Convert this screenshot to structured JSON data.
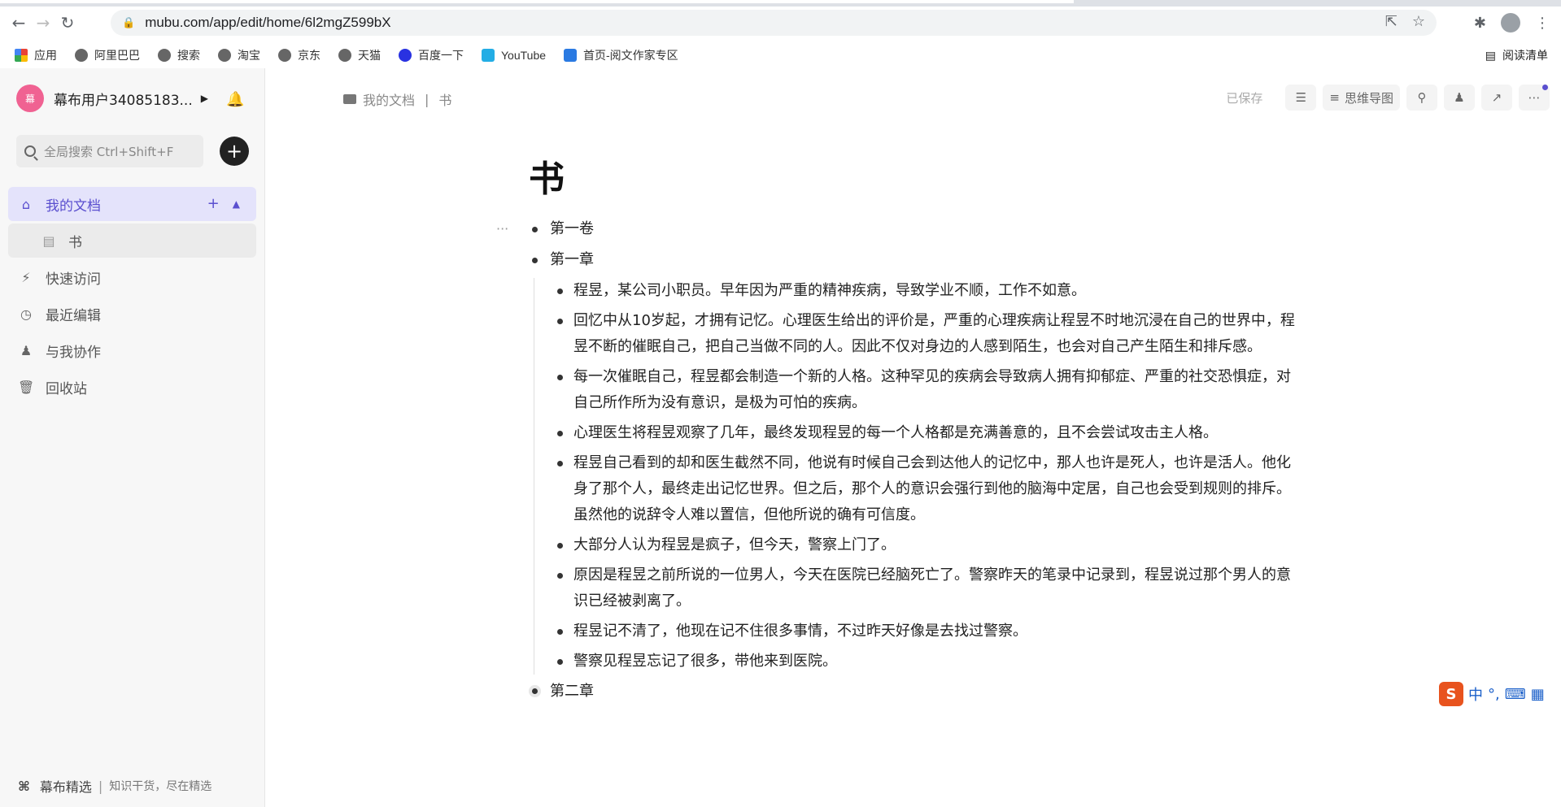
{
  "browser": {
    "url": "mubu.com/app/edit/home/6l2mgZ599bX",
    "bookmarks": [
      "应用",
      "阿里巴巴",
      "搜索",
      "淘宝",
      "京东",
      "天猫",
      "百度一下",
      "YouTube",
      "首页-阅文作家专区"
    ],
    "reading_list": "阅读清单"
  },
  "sidebar": {
    "avatar_text": "幕",
    "username": "幕布用户34085183...",
    "search_placeholder": "全局搜索 Ctrl+Shift+F",
    "items": [
      {
        "label": "我的文档",
        "icon": "home-icon"
      },
      {
        "label": "书",
        "icon": "doc-icon"
      },
      {
        "label": "快速访问",
        "icon": "lightning-icon"
      },
      {
        "label": "最近编辑",
        "icon": "clock-icon"
      },
      {
        "label": "与我协作",
        "icon": "people-icon"
      },
      {
        "label": "回收站",
        "icon": "trash-icon"
      }
    ],
    "featured": {
      "label": "幕布精选",
      "tagline": "知识干货，尽在精选"
    }
  },
  "header": {
    "breadcrumb_root": "我的文档",
    "breadcrumb_current": "书",
    "saved": "已保存",
    "mindmap": "思维导图"
  },
  "document": {
    "title": "书",
    "top_items": [
      "第一卷",
      "第一章",
      "第二章"
    ],
    "chapter1": [
      "程昱，某公司小职员。早年因为严重的精神疾病，导致学业不顺，工作不如意。",
      "回忆中从10岁起，才拥有记忆。心理医生给出的评价是，严重的心理疾病让程昱不时地沉浸在自己的世界中，程昱不断的催眠自己，把自己当做不同的人。因此不仅对身边的人感到陌生，也会对自己产生陌生和排斥感。",
      "每一次催眠自己，程昱都会制造一个新的人格。这种罕见的疾病会导致病人拥有抑郁症、严重的社交恐惧症，对自己所作所为没有意识，是极为可怕的疾病。",
      "心理医生将程昱观察了几年，最终发现程昱的每一个人格都是充满善意的，且不会尝试攻击主人格。",
      "程昱自己看到的却和医生截然不同，他说有时候自己会到达他人的记忆中，那人也许是死人，也许是活人。他化身了那个人，最终走出记忆世界。但之后，那个人的意识会强行到他的脑海中定居，自己也会受到规则的排斥。虽然他的说辞令人难以置信，但他所说的确有可信度。",
      "大部分人认为程昱是疯子，但今天，警察上门了。",
      "原因是程昱之前所说的一位男人，今天在医院已经脑死亡了。警察昨天的笔录中记录到，程昱说过那个男人的意识已经被剥离了。",
      "程昱记不清了，他现在记不住很多事情，不过昨天好像是去找过警察。",
      "警察见程昱忘记了很多，带他来到医院。"
    ]
  },
  "ime": {
    "logo": "S",
    "lang": "中",
    "punct": "°,"
  }
}
